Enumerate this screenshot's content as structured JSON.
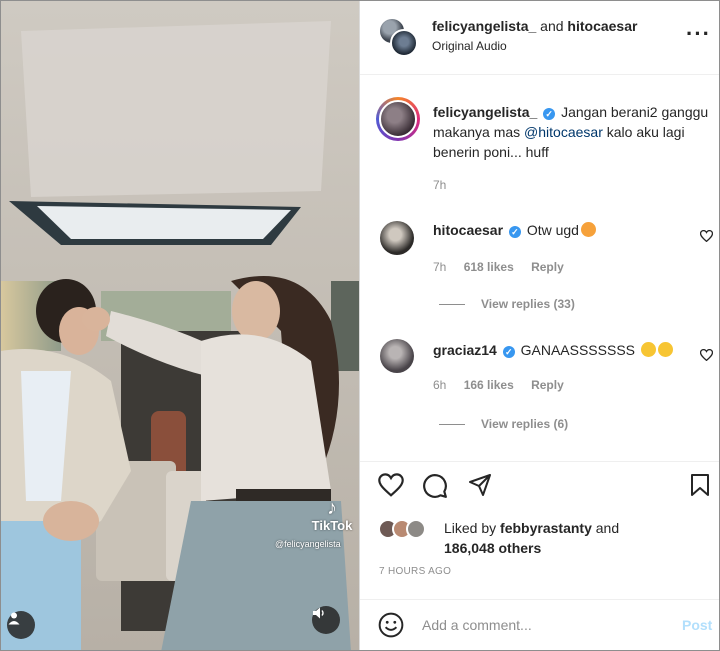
{
  "header": {
    "user1": "felicyangelista_",
    "joiner": "and",
    "user2": "hitocaesar",
    "audio": "Original Audio",
    "more_icon": "more-horizontal-icon"
  },
  "caption": {
    "username": "felicyangelista_",
    "text_before_mention": "Jangan berani2 ganggu makanya mas",
    "mention": "@hitocaesar",
    "text_after_mention": "kalo aku lagi benerin poni... huff",
    "time": "7h"
  },
  "comments": [
    {
      "username": "hitocaesar",
      "text": "Otw ugd",
      "emoji": "angry-face-emoji",
      "time": "7h",
      "likes": "618 likes",
      "reply": "Reply",
      "view_replies": "View replies (33)"
    },
    {
      "username": "graciaz14",
      "text": "GANAASSSSSSS",
      "emoji": "laughing-face-emoji",
      "time": "6h",
      "likes": "166 likes",
      "reply": "Reply",
      "view_replies": "View replies (6)"
    }
  ],
  "likes": {
    "prefix": "Liked by",
    "user": "febbyrastanty",
    "and": "and",
    "count": "186,048 others"
  },
  "date": "7 HOURS AGO",
  "comment_box": {
    "placeholder": "Add a comment...",
    "post": "Post"
  },
  "video": {
    "logo": "TikTok",
    "handle": "@felicyangelista"
  },
  "colors": {
    "verified": "#3897f0",
    "link": "#00376b",
    "post_disabled": "#b2dffc",
    "muted": "#8e8e8e"
  }
}
